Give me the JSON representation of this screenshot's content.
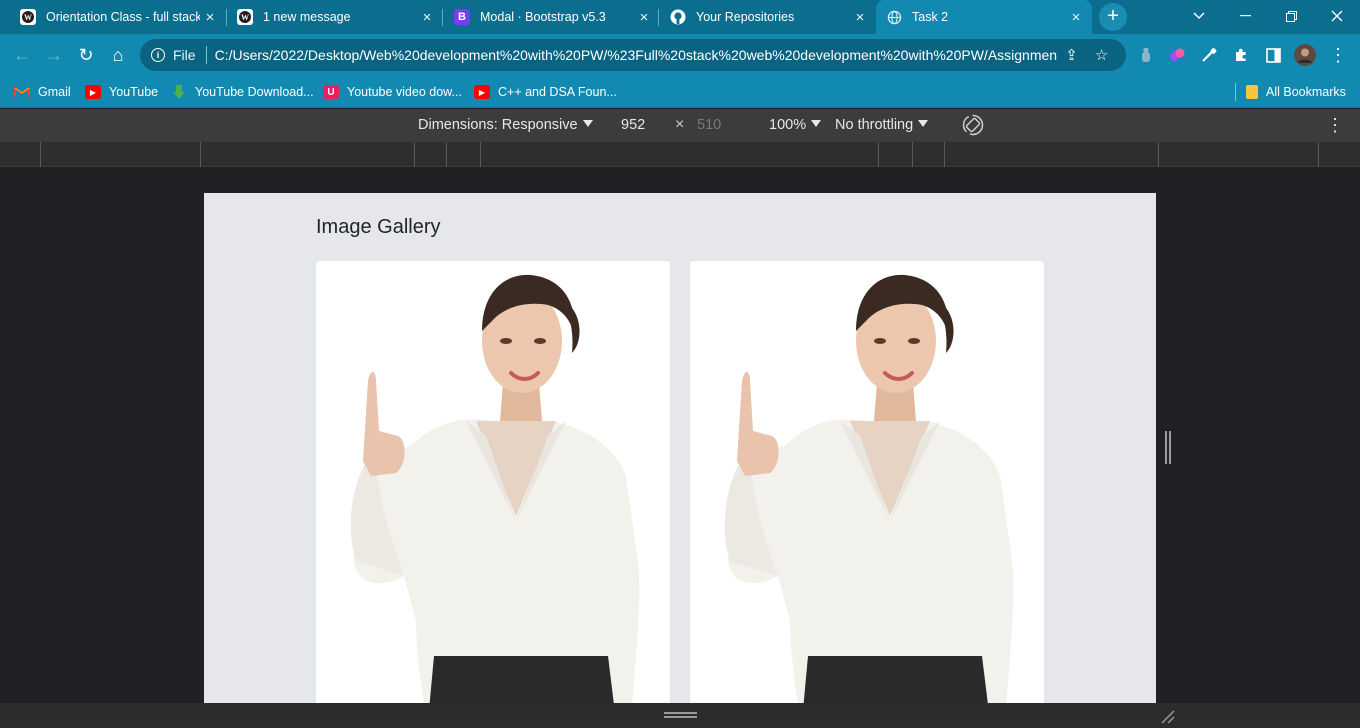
{
  "tabs": [
    {
      "title": "Orientation Class - full stack",
      "favicon": "wordpress-icon",
      "active": false
    },
    {
      "title": "1 new message",
      "favicon": "wordpress-icon",
      "active": false
    },
    {
      "title": "Modal · Bootstrap v5.3",
      "favicon": "bootstrap-icon",
      "active": false
    },
    {
      "title": "Your Repositories",
      "favicon": "github-icon",
      "active": false
    },
    {
      "title": "Task 2",
      "favicon": "globe-icon",
      "active": true
    }
  ],
  "tab_close_glyph": "×",
  "new_tab_glyph": "+",
  "bootstrap_favicon_letter": "B",
  "window": {
    "minimize": "—",
    "restore": "❐",
    "close": "✕",
    "tab_search": "⌄"
  },
  "toolbar": {
    "back": "←",
    "forward": "→",
    "reload": "↻",
    "home": "⌂",
    "scheme_label": "File",
    "url": "C:/Users/2022/Desktop/Web%20development%20with%20PW/%23Full%20stack%20web%20development%20with%20PW/Assignmen...",
    "share_glyph": "⇪",
    "star_glyph": "☆",
    "menu_glyph": "⋮"
  },
  "bookmarks": [
    {
      "label": "Gmail",
      "icon": "gmail-icon",
      "color": "#ea4335"
    },
    {
      "label": "YouTube",
      "icon": "youtube-icon",
      "color": "#ff0000"
    },
    {
      "label": "YouTube Download...",
      "icon": "download-icon",
      "color": "#4caf50"
    },
    {
      "label": "Youtube video dow...",
      "icon": "u-icon",
      "color": "#e91e63"
    },
    {
      "label": "C++ and DSA Foun...",
      "icon": "youtube-icon",
      "color": "#ff0000"
    }
  ],
  "all_bookmarks": {
    "label": "All Bookmarks",
    "icon": "folder-icon",
    "color": "#f5c542"
  },
  "devtools": {
    "dimensions_label": "Dimensions: Responsive",
    "width": "952",
    "times": "×",
    "height": "510",
    "zoom": "100%",
    "throttling": "No throttling",
    "more_glyph": "⋮"
  },
  "page": {
    "title": "Image Gallery",
    "cards": [
      {
        "image": "woman-pointing-photo",
        "alt": ""
      },
      {
        "image": "woman-pointing-photo",
        "alt": ""
      }
    ]
  },
  "colors": {
    "tab_bar": "#0b6e8e",
    "toolbar": "#1189b0",
    "viewport_bg": "#e6e7eb"
  }
}
